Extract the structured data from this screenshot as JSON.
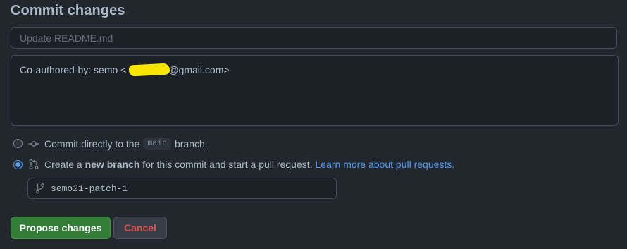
{
  "header": {
    "title": "Commit changes"
  },
  "commit_form": {
    "summary_placeholder": "Update README.md",
    "summary_value": "",
    "description": {
      "prefix": "Co-authored-by: semo <",
      "suffix": "@gmail.com>"
    }
  },
  "options": {
    "direct": {
      "label_before": "Commit directly to the",
      "branch": "main",
      "label_after": "branch.",
      "selected": false
    },
    "new_branch": {
      "label_before": "Create a",
      "bold": "new branch",
      "label_after": "for this commit and start a pull request.",
      "link": "Learn more about pull requests.",
      "selected": true
    }
  },
  "branch_name": {
    "value": "semo21-patch-1"
  },
  "actions": {
    "propose_label": "Propose changes",
    "cancel_label": "Cancel"
  },
  "colors": {
    "background": "#22272e",
    "accent_blue": "#539bf5",
    "primary_green": "#347d39",
    "danger_red": "#e5534b"
  }
}
